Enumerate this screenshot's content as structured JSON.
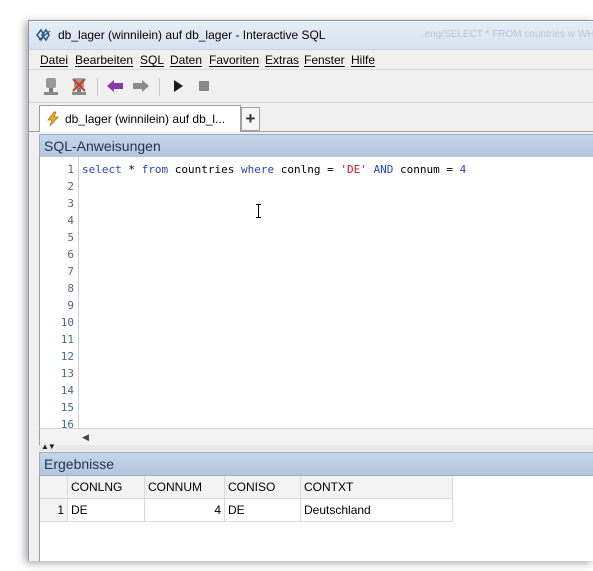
{
  "window": {
    "title": "db_lager (winnilein) auf db_lager - Interactive SQL",
    "background_title": "..eng/SELECT * FROM countries w WHERE c"
  },
  "menu": [
    "Datei",
    "Bearbeiten",
    "SQL",
    "Daten",
    "Favoriten",
    "Extras",
    "Fenster",
    "Hilfe"
  ],
  "toolbar": {
    "buttons": [
      "connect-icon",
      "disconnect-icon",
      "back-arrow-icon",
      "forward-arrow-icon",
      "run-icon",
      "stop-icon"
    ]
  },
  "tabs": {
    "active_label": "db_lager (winnilein) auf db_l...",
    "add_label": "+"
  },
  "editor": {
    "header": "SQL-Anweisungen",
    "line_numbers": [
      "1",
      "2",
      "3",
      "4",
      "5",
      "6",
      "7",
      "8",
      "9",
      "10",
      "11",
      "12",
      "13",
      "14",
      "15",
      "16"
    ],
    "query_tokens": [
      {
        "t": "select",
        "c": "kw"
      },
      {
        "t": " * ",
        "c": "plain"
      },
      {
        "t": "from",
        "c": "kw"
      },
      {
        "t": " countries ",
        "c": "plain"
      },
      {
        "t": "where",
        "c": "kw"
      },
      {
        "t": " conlng = ",
        "c": "plain"
      },
      {
        "t": "'DE'",
        "c": "str"
      },
      {
        "t": " ",
        "c": "plain"
      },
      {
        "t": "AND",
        "c": "kw"
      },
      {
        "t": " connum = ",
        "c": "plain"
      },
      {
        "t": "4",
        "c": "num"
      }
    ]
  },
  "results": {
    "header": "Ergebnisse",
    "columns": [
      "CONLNG",
      "CONNUM",
      "CONISO",
      "CONTXT"
    ],
    "rows": [
      {
        "row_number": "1",
        "CONLNG": "DE",
        "CONNUM": "4",
        "CONISO": "DE",
        "CONTXT": "Deutschland"
      }
    ]
  },
  "colors": {
    "panel_header": "#b9cbe0",
    "keyword": "#2a45c4",
    "string": "#d0102a",
    "number": "#1a48c9"
  }
}
